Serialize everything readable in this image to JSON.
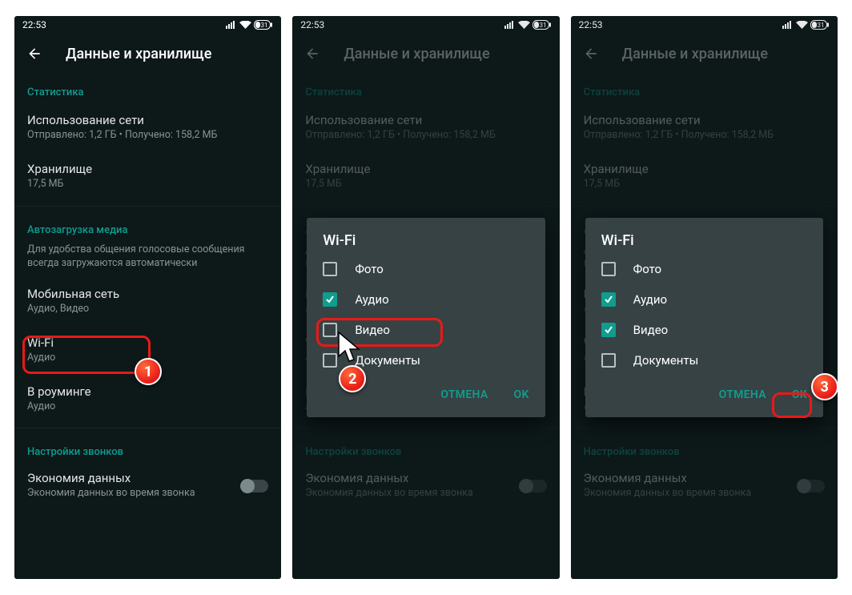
{
  "statusbar": {
    "time": "22:53",
    "battery": "31"
  },
  "toolbar": {
    "title": "Данные и хранилище"
  },
  "sections": {
    "stats_header": "Статистика",
    "network_usage_title": "Использование сети",
    "network_usage_sub": "Отправлено: 1,2 ГБ • Получено: 158,2 МБ",
    "storage_title": "Хранилище",
    "storage_sub": "17,5 МБ",
    "auto_header": "Автозагрузка медиа",
    "auto_desc": "Для удобства общения голосовые сообщения всегда загружаются автоматически",
    "mobile_title": "Мобильная сеть",
    "mobile_sub": "Аудио, Видео",
    "wifi_title": "Wi-Fi",
    "wifi_sub": "Аудио",
    "roaming_title": "В роуминге",
    "roaming_sub": "Аудио",
    "calls_header": "Настройки звонков",
    "economy_title": "Экономия данных",
    "economy_sub": "Экономия данных во время звонка"
  },
  "dialog": {
    "title": "Wi-Fi",
    "opts": [
      "Фото",
      "Аудио",
      "Видео",
      "Документы"
    ],
    "cancel": "ОТМЕНА",
    "ok": "OK"
  },
  "badges": [
    "1",
    "2",
    "3"
  ]
}
